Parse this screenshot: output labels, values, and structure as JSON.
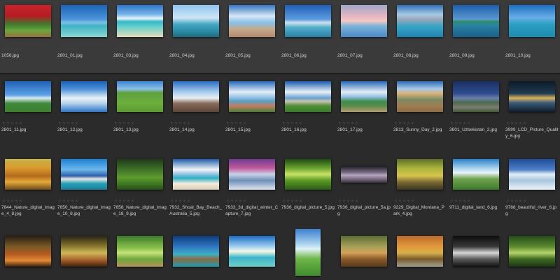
{
  "thumbnails": [
    {
      "name": "1056.jpg",
      "bg": "linear-gradient(180deg,#c8232b 0%,#b51d22 35%,#3f7a2e 60%,#6aa63b 80%,#9a6b45 100%)",
      "w": 66,
      "h": 46
    },
    {
      "name": "2801_01.jpg",
      "bg": "linear-gradient(180deg,#1d63b6 0%,#4d95da 45%,#7fc0e6 55%,#3db5c6 65%,#8cd6d0 100%)",
      "w": 66,
      "h": 46
    },
    {
      "name": "2801_03.jpg",
      "bg": "linear-gradient(180deg,#2e74c9 0%,#79b6ea 30%,#e9f4f8 42%,#36b9c9 52%,#6fd1cd 70%,#e6dcb9 100%)",
      "w": 66,
      "h": 46
    },
    {
      "name": "2801_04.jpg",
      "bg": "linear-gradient(180deg,#8fc4ee 0%,#cfe6f6 40%,#47a7c3 60%,#2d8ea9 80%,#1f6b7d 100%)",
      "w": 66,
      "h": 46
    },
    {
      "name": "2801_05.jpg",
      "bg": "linear-gradient(180deg,#3575c4 0%,#d7e7f4 35%,#89c0e8 55%,#c4a98a 75%,#b48a6e 100%)",
      "w": 66,
      "h": 46
    },
    {
      "name": "2801_06.jpg",
      "bg": "linear-gradient(180deg,#1f5fb5 0%,#5e9be0 45%,#cfe0ef 55%,#50b0c8 70%,#2a7ea8 100%)",
      "w": 66,
      "h": 46
    },
    {
      "name": "2801_07.jpg",
      "bg": "linear-gradient(180deg,#9ea7c8 0%,#e5b6c2 35%,#f4c7c3 50%,#7fb4d9 65%,#4a88c7 100%)",
      "w": 66,
      "h": 46
    },
    {
      "name": "2801_08.jpg",
      "bg": "linear-gradient(180deg,#2f6fb4 0%,#a8c9e6 30%,#9aa7b7 45%,#3aa5c7 65%,#1f84b0 100%)",
      "w": 66,
      "h": 46
    },
    {
      "name": "2801_09.jpg",
      "bg": "linear-gradient(180deg,#1c5ea9 0%,#5c98d4 45%,#2d8f5a 52%,#2a86a3 60%,#1b5f8c 100%)",
      "w": 66,
      "h": 46
    },
    {
      "name": "2801_10.jpg",
      "bg": "linear-gradient(180deg,#1d6dc0 0%,#69aee6 40%,#2aa0c2 60%,#1f89ae 100%)",
      "w": 66,
      "h": 46
    },
    {
      "name": "2801_11.jpg",
      "bg": "linear-gradient(180deg,#1f62b7 0%,#5ea1e6 45%,#dce9f2 55%,#3f8a3b 72%,#3d7f2e 100%)",
      "w": 66,
      "h": 44
    },
    {
      "name": "2801_12.jpg",
      "bg": "linear-gradient(180deg,#1c61b5 0%,#4a8fd8 25%,#e9f1f6 55%,#bcd7ee 70%,#2c75c6 100%)",
      "w": 66,
      "h": 44
    },
    {
      "name": "2801_13.jpg",
      "bg": "linear-gradient(180deg,#3b85d3 0%,#8cbfe9 25%,#5ea03d 38%,#6caf3d 70%,#5d9a33 100%)",
      "w": 66,
      "h": 44
    },
    {
      "name": "2801_14.jpg",
      "bg": "linear-gradient(180deg,#2a6cc2 0%,#a7cdee 35%,#e9eef1 55%,#8a6b5a 72%,#5a4438 100%)",
      "w": 66,
      "h": 44
    },
    {
      "name": "2801_15.jpg",
      "bg": "linear-gradient(180deg,#2567ba 0%,#e4eef6 35%,#88bbe0 55%,#5aa0c0 65%,#c47d63 80%,#4a7d3a 100%)",
      "w": 66,
      "h": 44
    },
    {
      "name": "2801_16.jpg",
      "bg": "linear-gradient(180deg,#1b5cb1 0%,#e8f0f6 35%,#6aa0d0 55%,#c9c3b0 65%,#4e8f35 80%,#3a7a2b 100%)",
      "w": 66,
      "h": 44
    },
    {
      "name": "2801_17.jpg",
      "bg": "linear-gradient(180deg,#2767b9 0%,#e3ecf3 35%,#97c2e6 50%,#3f8d52 65%,#5a8c48 80%,#b59b73 100%)",
      "w": 66,
      "h": 44
    },
    {
      "name": "2813_Sunny_Day_2.jpg",
      "bg": "linear-gradient(180deg,#2f6ab4 0%,#a8c8e8 25%,#dab27a 40%,#7a8b63 60%,#a07d52 80%,#8a6c48 100%)",
      "w": 66,
      "h": 44
    },
    {
      "name": "3801_Uzbekistan_2.jpg",
      "bg": "linear-gradient(180deg,#1a2e63 0%,#2f4d8f 40%,#6a7fa8 55%,#506a4f 70%,#7b7d6c 85%,#3f5a38 100%)",
      "w": 66,
      "h": 44
    },
    {
      "name": "3999_LCD_Picture_Quality_6.jpg",
      "bg": "linear-gradient(180deg,#0c1a28 0%,#223b52 40%,#d8b25a 55%,#3c5b7b 70%,#0f1c2a 100%)",
      "w": 66,
      "h": 44
    },
    {
      "name": "7844_Nature_digital_image_4_8.jpg",
      "bg": "linear-gradient(180deg,#c6b24b 0%,#d99a2c 30%,#b36a1c 55%,#e5a93a 75%,#6b4a1b 100%)",
      "w": 66,
      "h": 44
    },
    {
      "name": "7850_Nature_digital_image_10_8.jpg",
      "bg": "linear-gradient(180deg,#1d7fd0 0%,#6cb7ec 35%,#2f5fa8 55%,#e7e7e7 65%,#26a0b5 80%,#1f7da0 100%)",
      "w": 66,
      "h": 44
    },
    {
      "name": "7858_Nature_digital_image_18_9.jpg",
      "bg": "linear-gradient(180deg,#20381a 0%,#3a6b25 30%,#5e9a2e 60%,#3f7a22 80%,#28501b 100%)",
      "w": 66,
      "h": 44
    },
    {
      "name": "7932_Shoal_Bay_Beach_Australia_5.jpg",
      "bg": "linear-gradient(180deg,#1e5aa8 0%,#f2f5f7 35%,#8fc0e1 50%,#2cb0c6 62%,#f3ecdc 80%,#d9cfb8 100%)",
      "w": 66,
      "h": 44
    },
    {
      "name": "7933_3d_digital_winter_Capture_7.jpg",
      "bg": "linear-gradient(180deg,#6a3a8e 0%,#c45a9e 30%,#c7d2e8 50%,#6f8fb7 70%,#dfe6f0 100%)",
      "w": 66,
      "h": 44
    },
    {
      "name": "7936_digital_picture_5.jpg",
      "bg": "linear-gradient(180deg,#1d4a15 0%,#6aa32e 30%,#c8e266 50%,#5a9a25 70%,#2c5d18 100%)",
      "w": 66,
      "h": 44
    },
    {
      "name": "7936_digital_picture_5a.jpg",
      "bg": "linear-gradient(180deg,#1d1a22 0%,#7b6e86 40%,#b8a6c0 55%,#3a3240 100%)",
      "w": 66,
      "h": 24
    },
    {
      "name": "9229_Digital_Montana_Park_4.jpg",
      "bg": "linear-gradient(180deg,#5d6d2a 0%,#a9b43a 30%,#d7c44e 55%,#7c6a34 75%,#3a3622 100%)",
      "w": 66,
      "h": 44
    },
    {
      "name": "9711_digital_land_6.jpg",
      "bg": "linear-gradient(180deg,#2b7ec7 0%,#a6d2ee 30%,#e8f3f7 45%,#6ea24c 65%,#3f7a2d 100%)",
      "w": 66,
      "h": 44
    },
    {
      "name": "9788_beautiful_river_6.jpg",
      "bg": "linear-gradient(180deg,#1e4a96 0%,#4e80c8 35%,#e2eef6 50%,#a8c6df 70%,#f0f5f8 100%)",
      "w": 66,
      "h": 44
    },
    {
      "name": "",
      "bg": "linear-gradient(180deg,#2a1e12 0%,#7a5a26 35%,#b85a22 60%,#e08a35 80%,#3a200f 100%)",
      "w": 66,
      "h": 44
    },
    {
      "name": "",
      "bg": "linear-gradient(180deg,#2b2413 0%,#8a7a2f 35%,#d0b85a 55%,#a25a26 80%,#3a2310 100%)",
      "w": 66,
      "h": 44
    },
    {
      "name": "",
      "bg": "linear-gradient(180deg,#3b7b2c 0%,#8cc24d 40%,#c7e27a 55%,#6aa83a 75%,#b7905b 100%)",
      "w": 66,
      "h": 44
    },
    {
      "name": "",
      "bg": "linear-gradient(180deg,#0f3d7a 0%,#2f77c2 35%,#3db0c3 60%,#8b6b45 75%,#1f9bb0 100%)",
      "w": 66,
      "h": 44
    },
    {
      "name": "",
      "bg": "linear-gradient(180deg,#1c6dc6 0%,#9fd0f0 35%,#f6f8e4 50%,#3db5c9 70%,#6ed0c7 100%)",
      "w": 66,
      "h": 44
    },
    {
      "name": "",
      "bg": "linear-gradient(180deg,#2d74c9 0%,#a9d3ef 35%,#e3f2f7 45%,#6fb74a 65%,#3f8b2e 100%)",
      "w": 36,
      "h": 70
    },
    {
      "name": "",
      "bg": "linear-gradient(180deg,#5c6d33 0%,#a6a15a 35%,#d3a258 55%,#8a5a2b 75%,#5a3a1c 100%)",
      "w": 66,
      "h": 44
    },
    {
      "name": "",
      "bg": "linear-gradient(180deg,#b96a2a 0%,#e39a3c 35%,#d5b04a 55%,#7a5a2a 75%,#a4a091 100%)",
      "w": 66,
      "h": 44
    },
    {
      "name": "",
      "bg": "linear-gradient(180deg,#0d0d0d 0%,#3a3a3a 35%,#d7d7d7 55%,#5a5a5a 75%,#111 100%)",
      "w": 66,
      "h": 44
    },
    {
      "name": "",
      "bg": "linear-gradient(180deg,#254d1c 0%,#5a8a2f 35%,#b6d46a 55%,#3f6a24 75%,#1b3614 100%)",
      "w": 66,
      "h": 44
    }
  ],
  "selected_index": [
    0,
    1,
    2,
    3,
    4,
    5,
    6,
    7,
    8,
    9
  ]
}
